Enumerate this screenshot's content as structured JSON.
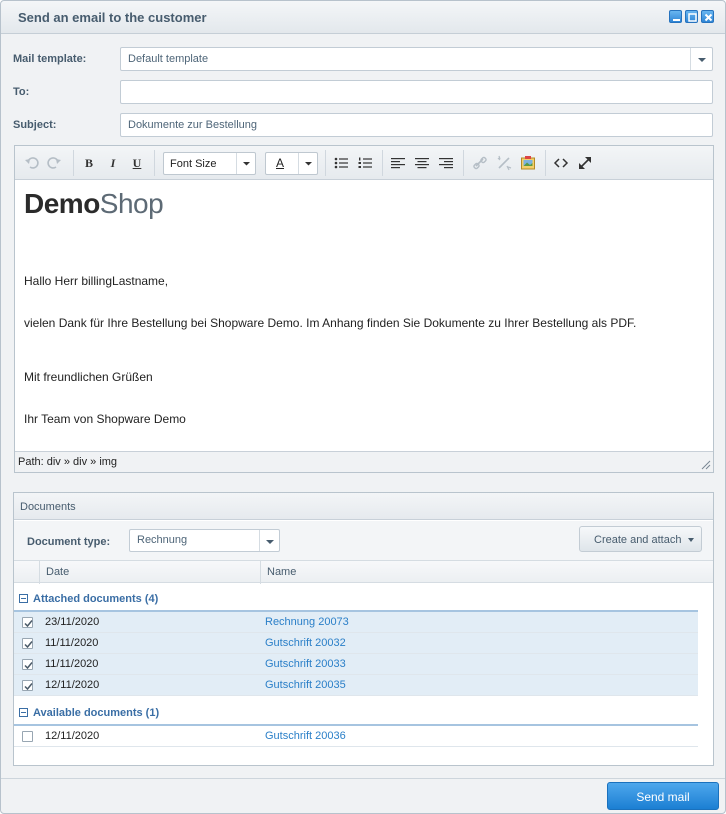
{
  "window": {
    "title": "Send an email to the customer"
  },
  "form": {
    "mail_template_label": "Mail template:",
    "mail_template_value": "Default template",
    "to_label": "To:",
    "to_value": "",
    "subject_label": "Subject:",
    "subject_value": "Dokumente zur Bestellung"
  },
  "toolbar": {
    "bold": "B",
    "italic": "I",
    "underline": "U",
    "font_size": "Font Size",
    "text_color": "A"
  },
  "editor": {
    "logo_bold": "Demo",
    "logo_light": "Shop",
    "lines": [
      "Hallo Herr billingLastname,",
      "vielen Dank für Ihre Bestellung bei Shopware Demo. Im Anhang finden Sie Dokumente zu Ihrer Bestellung als PDF.",
      "Mit freundlichen Grüßen",
      "Ihr Team von Shopware Demo"
    ],
    "path": "Path: div » div » img"
  },
  "documents": {
    "title": "Documents",
    "type_label": "Document type:",
    "type_value": "Rechnung",
    "create_button": "Create and attach",
    "columns": [
      "Date",
      "Name"
    ],
    "attached_group": "Attached documents (4)",
    "available_group": "Available documents (1)",
    "attached": [
      {
        "date": "23/11/2020",
        "name": "Rechnung 20073",
        "checked": true
      },
      {
        "date": "11/11/2020",
        "name": "Gutschrift 20032",
        "checked": true
      },
      {
        "date": "11/11/2020",
        "name": "Gutschrift 20033",
        "checked": true
      },
      {
        "date": "12/11/2020",
        "name": "Gutschrift 20035",
        "checked": true
      }
    ],
    "available": [
      {
        "date": "12/11/2020",
        "name": "Gutschrift 20036",
        "checked": false
      }
    ]
  },
  "send_button": "Send mail"
}
